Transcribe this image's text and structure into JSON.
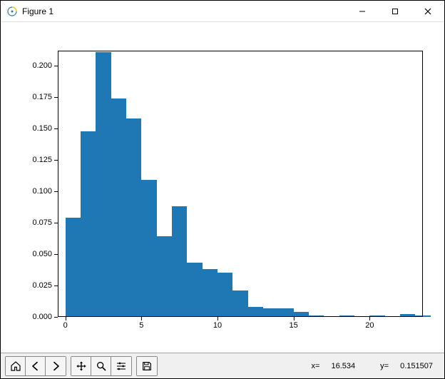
{
  "window": {
    "title": "Figure 1"
  },
  "chart_data": {
    "type": "bar",
    "subtype": "histogram",
    "title": "",
    "xlabel": "",
    "ylabel": "",
    "xlim": [
      -0.5,
      23.5
    ],
    "ylim": [
      0,
      0.212
    ],
    "x_ticks": [
      0,
      5,
      10,
      15,
      20
    ],
    "y_ticks": [
      0.0,
      0.025,
      0.05,
      0.075,
      0.1,
      0.125,
      0.15,
      0.175,
      0.2
    ],
    "y_tick_labels": [
      "0.000",
      "0.025",
      "0.050",
      "0.075",
      "0.100",
      "0.125",
      "0.150",
      "0.175",
      "0.200"
    ],
    "bin_edges": [
      0,
      1,
      2,
      3,
      4,
      5,
      6,
      7,
      8,
      9,
      10,
      11,
      12,
      13,
      14,
      15,
      16,
      17,
      18,
      19,
      20,
      21,
      22,
      23
    ],
    "values": [
      0.079,
      0.148,
      0.211,
      0.174,
      0.158,
      0.109,
      0.064,
      0.088,
      0.043,
      0.038,
      0.035,
      0.021,
      0.008,
      0.007,
      0.007,
      0.004,
      0.001,
      0.0,
      0.001,
      0.0,
      0.001,
      0.0,
      0.002,
      0.001
    ],
    "bar_color": "#1f77b4"
  },
  "toolbar": {
    "icons": {
      "home": "home-icon",
      "back": "arrow-left-icon",
      "forward": "arrow-right-icon",
      "pan": "move-icon",
      "zoom": "zoom-icon",
      "subplots": "sliders-icon",
      "save": "save-icon"
    },
    "coords_x_label": "x=",
    "coords_x_value": "16.534",
    "coords_y_label": "y=",
    "coords_y_value": "0.151507"
  }
}
